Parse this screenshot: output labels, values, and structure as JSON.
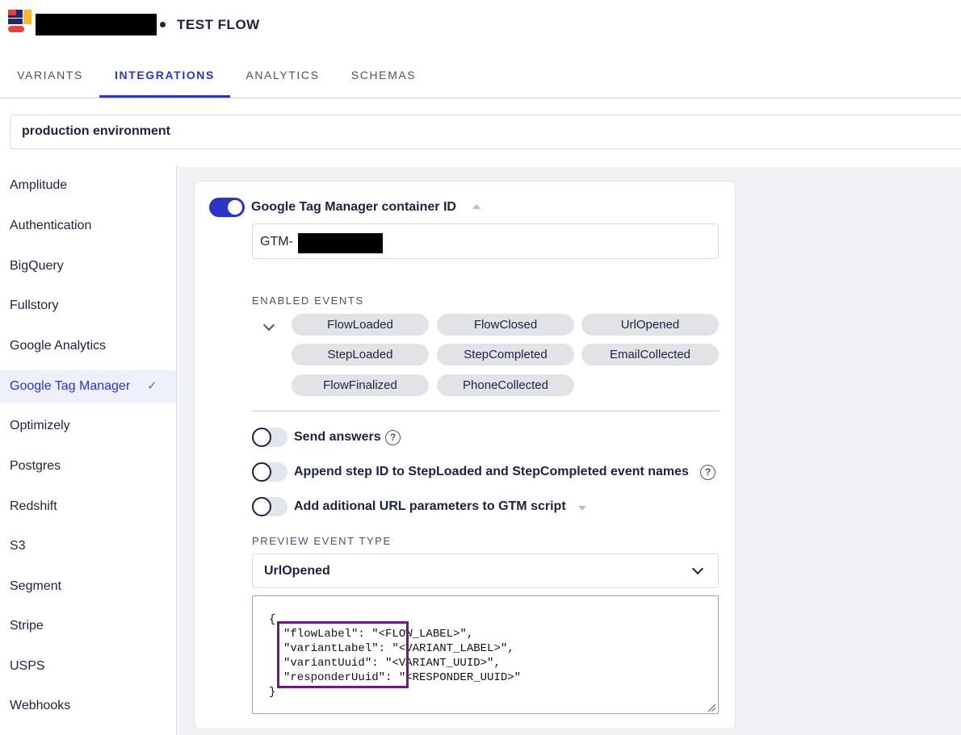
{
  "header": {
    "title": "TEST FLOW"
  },
  "tabs": [
    {
      "label": "VARIANTS",
      "active": false
    },
    {
      "label": "INTEGRATIONS",
      "active": true
    },
    {
      "label": "ANALYTICS",
      "active": false
    },
    {
      "label": "SCHEMAS",
      "active": false
    }
  ],
  "environment": {
    "label": "production environment"
  },
  "sidebar": {
    "items": [
      {
        "label": "Amplitude"
      },
      {
        "label": "Authentication"
      },
      {
        "label": "BigQuery"
      },
      {
        "label": "Fullstory"
      },
      {
        "label": "Google Analytics"
      },
      {
        "label": "Google Tag Manager",
        "selected": true,
        "check": "✓"
      },
      {
        "label": "Optimizely"
      },
      {
        "label": "Postgres"
      },
      {
        "label": "Redshift"
      },
      {
        "label": "S3"
      },
      {
        "label": "Segment"
      },
      {
        "label": "Stripe"
      },
      {
        "label": "USPS"
      },
      {
        "label": "Webhooks"
      }
    ]
  },
  "gtm": {
    "toggle_label": "Google Tag Manager container ID",
    "enabled": true,
    "container_id_prefix": "GTM-",
    "enabled_events_title": "ENABLED EVENTS",
    "events": [
      "FlowLoaded",
      "FlowClosed",
      "UrlOpened",
      "StepLoaded",
      "StepCompleted",
      "EmailCollected",
      "FlowFinalized",
      "PhoneCollected"
    ],
    "options": [
      {
        "label": "Send answers",
        "enabled": false,
        "help": "?"
      },
      {
        "label": "Append step ID to StepLoaded and StepCompleted event names",
        "enabled": false,
        "help": "?"
      },
      {
        "label": "Add aditional URL parameters to GTM script",
        "enabled": false
      }
    ],
    "preview_title": "PREVIEW EVENT TYPE",
    "preview_selected": "UrlOpened",
    "preview_code": {
      "open": "{",
      "lines": [
        "\"flowLabel\": \"<FLOW_LABEL>\",",
        "\"variantLabel\": \"<VARIANT_LABEL>\",",
        "\"variantUuid\": \"<VARIANT_UUID>\",",
        "\"responderUuid\": \"<RESPONDER_UUID>\""
      ],
      "close": "}"
    }
  },
  "colors": {
    "accent": "#2b35c9",
    "text": "#1c2340",
    "highlight_box": "#6e1b7e",
    "chip_bg": "#e2e3e6",
    "main_bg": "#f0f1f5"
  }
}
